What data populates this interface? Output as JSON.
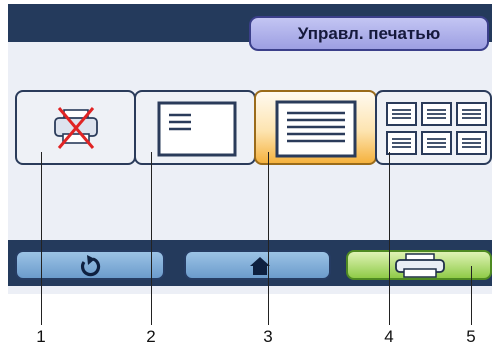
{
  "header": {
    "title": "Управл. печатью"
  },
  "tiles": [
    {
      "icon": "printer-disabled-icon"
    },
    {
      "icon": "single-page-small-icon"
    },
    {
      "icon": "single-page-large-icon",
      "selected": true
    },
    {
      "icon": "multi-page-grid-icon"
    }
  ],
  "buttons": [
    {
      "icon": "back-arrow-icon"
    },
    {
      "icon": "home-icon"
    },
    {
      "icon": "printer-icon"
    }
  ],
  "callouts": [
    "1",
    "2",
    "3",
    "4",
    "5"
  ]
}
